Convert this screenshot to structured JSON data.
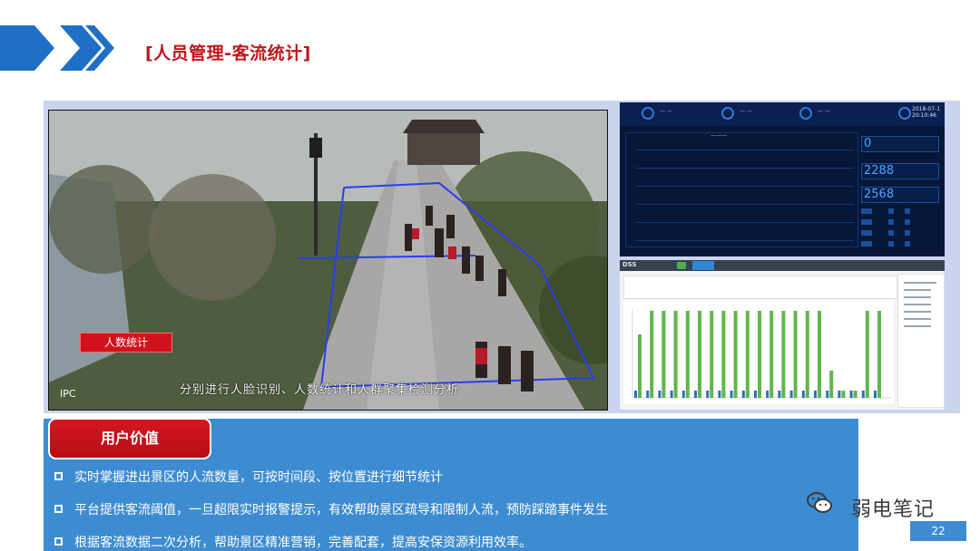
{
  "header": {
    "title": "[人员管理-客流统计]"
  },
  "camera": {
    "overlay_label": "人数统计",
    "source_label": "IPC",
    "caption": "分别进行人脸识别、人数统计和人群聚集检测分析"
  },
  "dashboard": {
    "date": "2018-07-1",
    "time": "20:10:46",
    "kpis": [
      "0",
      "2288",
      "2568"
    ]
  },
  "dss": {
    "logo": "DSS"
  },
  "user_value": {
    "badge": "用户价值",
    "bullets": [
      "实时掌握进出景区的人流数量，可按时间段、按位置进行细节统计",
      "平台提供客流阈值，一旦超限实时报警提示，有效帮助景区疏导和限制人流，预防踩踏事件发生",
      "根据客流数据二次分析，帮助景区精准营销，完善配套，提高安保资源利用效率。"
    ]
  },
  "watermark": {
    "text": "弱电笔记",
    "icon": "wechat-icon"
  },
  "page": {
    "number": "22"
  },
  "colors": {
    "accent_red": "#c0141b",
    "panel_blue": "#3d8cd1",
    "chevron_blue": "#1f6fc6"
  }
}
